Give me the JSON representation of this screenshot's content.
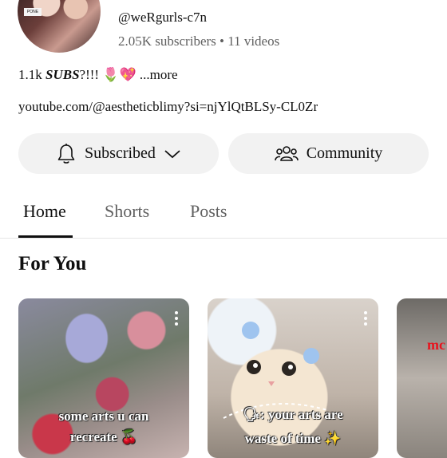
{
  "channel": {
    "handle": "@weRgurls-c7n",
    "subscribers": "2.05K subscribers",
    "separator": "•",
    "videos": "11 videos",
    "avatar_tag": "PONE"
  },
  "description": {
    "prefix": "1.1k ",
    "subs": "SUBS",
    "suffix": "?!!! ",
    "emoji": "🌷💖",
    "more": " ...more"
  },
  "link": "youtube.com/@aestheticblimy?si=njYlQtBLSy-CL0Zr",
  "buttons": {
    "subscribed": "Subscribed",
    "community": "Community"
  },
  "tabs": [
    {
      "label": "Home",
      "active": true
    },
    {
      "label": "Shorts",
      "active": false
    },
    {
      "label": "Posts",
      "active": false
    }
  ],
  "section": {
    "title": "For You"
  },
  "cards": [
    {
      "line1": "some arts u can",
      "line2": "recreate 🍒"
    },
    {
      "line1": "🗣: your arts are",
      "line2": "waste of time ✨"
    },
    {
      "line1": "mc"
    }
  ]
}
